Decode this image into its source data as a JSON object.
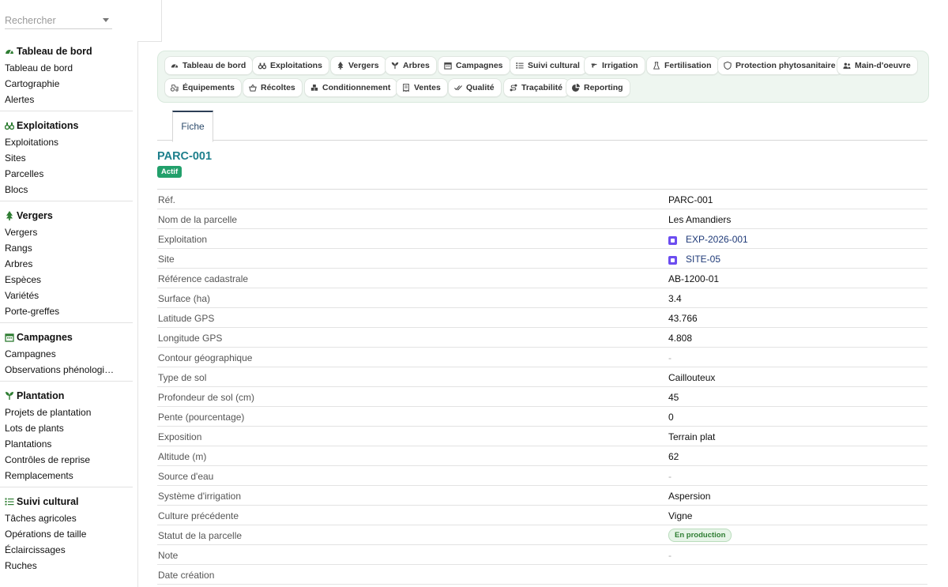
{
  "search": {
    "placeholder": "Rechercher"
  },
  "sidebar": {
    "groups": [
      {
        "title": "Tableau de bord",
        "icon": "gauge-icon",
        "items": [
          "Tableau de bord",
          "Cartographie",
          "Alertes"
        ]
      },
      {
        "title": "Exploitations",
        "icon": "binoculars-icon",
        "items": [
          "Exploitations",
          "Sites",
          "Parcelles",
          "Blocs"
        ]
      },
      {
        "title": "Vergers",
        "icon": "tree-icon",
        "items": [
          "Vergers",
          "Rangs",
          "Arbres",
          "Espèces",
          "Variétés",
          "Porte-greffes"
        ]
      },
      {
        "title": "Campagnes",
        "icon": "calendar-icon",
        "items": [
          "Campagnes",
          "Observations phénologiques"
        ]
      },
      {
        "title": "Plantation",
        "icon": "seedling-icon",
        "items": [
          "Projets de plantation",
          "Lots de plants",
          "Plantations",
          "Contrôles de reprise",
          "Remplacements"
        ]
      },
      {
        "title": "Suivi cultural",
        "icon": "list-icon",
        "items": [
          "Tâches agricoles",
          "Opérations de taille",
          "Éclaircissages",
          "Ruches"
        ]
      }
    ]
  },
  "modules": [
    {
      "label": "Tableau de bord",
      "icon": "gauge-icon"
    },
    {
      "label": "Exploitations",
      "icon": "binoculars-icon"
    },
    {
      "label": "Vergers",
      "icon": "tree-icon"
    },
    {
      "label": "Arbres",
      "icon": "seedling-icon"
    },
    {
      "label": "Campagnes",
      "icon": "calendar-icon"
    },
    {
      "label": "Suivi cultural",
      "icon": "list-icon"
    },
    {
      "label": "Irrigation",
      "icon": "faucet-icon"
    },
    {
      "label": "Fertilisation",
      "icon": "flask-icon"
    },
    {
      "label": "Protection phytosanitaire",
      "icon": "shield-icon"
    },
    {
      "label": "Main-d'oeuvre",
      "icon": "users-icon"
    },
    {
      "label": "Équipements",
      "icon": "tractor-icon"
    },
    {
      "label": "Récoltes",
      "icon": "basket-icon"
    },
    {
      "label": "Conditionnement",
      "icon": "boxes-icon"
    },
    {
      "label": "Ventes",
      "icon": "receipt-icon"
    },
    {
      "label": "Qualité",
      "icon": "check-double-icon"
    },
    {
      "label": "Traçabilité",
      "icon": "route-icon"
    },
    {
      "label": "Reporting",
      "icon": "chart-pie-icon"
    }
  ],
  "tabs": [
    {
      "label": "Fiche"
    }
  ],
  "record": {
    "title": "PARC-001",
    "badge": "Actif",
    "fields": [
      {
        "label": "Réf.",
        "value": "PARC-001"
      },
      {
        "label": "Nom de la parcelle",
        "value": "Les Amandiers"
      },
      {
        "label": "Exploitation",
        "value": "EXP-2026-001",
        "link": true
      },
      {
        "label": "Site",
        "value": "SITE-05",
        "link": true
      },
      {
        "label": "Référence cadastrale",
        "value": "AB-1200-01"
      },
      {
        "label": "Surface (ha)",
        "value": "3.4"
      },
      {
        "label": "Latitude GPS",
        "value": "43.766"
      },
      {
        "label": "Longitude GPS",
        "value": "4.808"
      },
      {
        "label": "Contour géographique",
        "value": "-"
      },
      {
        "label": "Type de sol",
        "value": "Caillouteux"
      },
      {
        "label": "Profondeur de sol (cm)",
        "value": "45"
      },
      {
        "label": "Pente (pourcentage)",
        "value": "0"
      },
      {
        "label": "Exposition",
        "value": "Terrain plat"
      },
      {
        "label": "Altitude (m)",
        "value": "62"
      },
      {
        "label": "Source d'eau",
        "value": "-"
      },
      {
        "label": "Système d'irrigation",
        "value": "Aspersion"
      },
      {
        "label": "Culture précédente",
        "value": "Vigne"
      },
      {
        "label": "Statut de la parcelle",
        "value": "En production",
        "status": true
      },
      {
        "label": "Note",
        "value": "-"
      },
      {
        "label": "Date création",
        "value": ""
      }
    ]
  },
  "colors": {
    "accent": "#1d7f8c",
    "badge": "#22a06b",
    "link": "#1f3a78",
    "icon_green": "#2e7d32"
  }
}
